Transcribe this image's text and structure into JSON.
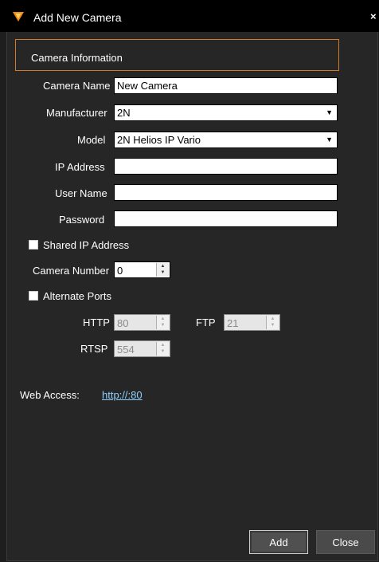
{
  "window": {
    "title": "Add New Camera",
    "close_glyph": "×"
  },
  "section": {
    "title": "Camera Information"
  },
  "form": {
    "camera_name_label": "Camera Name",
    "camera_name_value": "New Camera",
    "manufacturer_label": "Manufacturer",
    "manufacturer_value": "2N",
    "model_label": "Model",
    "model_value": "2N Helios IP Vario",
    "ip_address_label": "IP Address",
    "ip_address_value": "",
    "user_name_label": "User Name",
    "user_name_value": "",
    "password_label": "Password",
    "password_value": "",
    "shared_ip_label": "Shared IP Address",
    "camera_number_label": "Camera Number",
    "camera_number_value": "0",
    "alternate_ports_label": "Alternate Ports",
    "http_label": "HTTP",
    "http_value": "80",
    "ftp_label": "FTP",
    "ftp_value": "21",
    "rtsp_label": "RTSP",
    "rtsp_value": "554"
  },
  "web_access": {
    "label": "Web Access:",
    "link": "http://:80"
  },
  "buttons": {
    "add": "Add",
    "close": "Close"
  },
  "colors": {
    "accent": "#d2792a",
    "background": "#262626",
    "titlebar": "#000000",
    "link": "#8fd0ff"
  },
  "icons": {
    "app": "shield-logo-icon",
    "dropdown": "chevron-down-icon"
  }
}
